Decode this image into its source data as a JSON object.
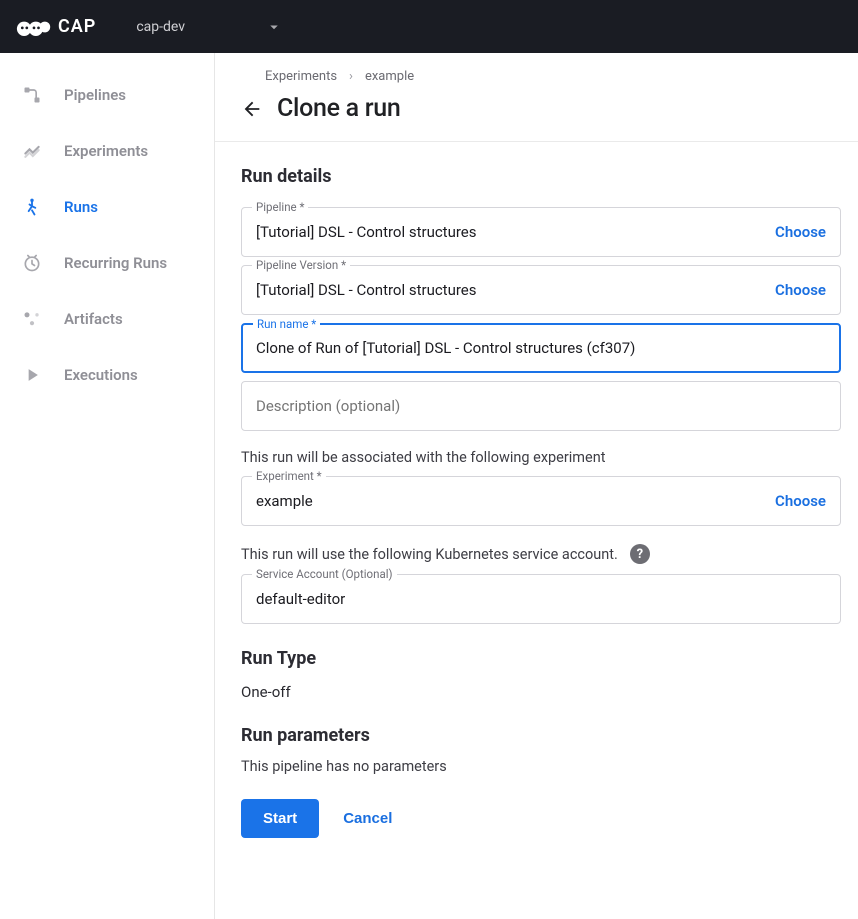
{
  "topbar": {
    "app_name": "CAP",
    "namespace": "cap-dev"
  },
  "sidebar": {
    "items": [
      {
        "label": "Pipelines",
        "icon": "pipelines"
      },
      {
        "label": "Experiments",
        "icon": "experiments"
      },
      {
        "label": "Runs",
        "icon": "runs",
        "active": true
      },
      {
        "label": "Recurring Runs",
        "icon": "clock"
      },
      {
        "label": "Artifacts",
        "icon": "artifacts"
      },
      {
        "label": "Executions",
        "icon": "play"
      }
    ]
  },
  "breadcrumb": {
    "root": "Experiments",
    "leaf": "example"
  },
  "page_title": "Clone a run",
  "sections": {
    "run_details": "Run details",
    "run_type": "Run Type",
    "run_parameters": "Run parameters"
  },
  "fields": {
    "pipeline": {
      "label": "Pipeline *",
      "value": "[Tutorial] DSL - Control structures",
      "action": "Choose"
    },
    "pipeline_version": {
      "label": "Pipeline Version *",
      "value": "[Tutorial] DSL - Control structures",
      "action": "Choose"
    },
    "run_name": {
      "label": "Run name *",
      "value": "Clone of Run of [Tutorial] DSL - Control structures (cf307)"
    },
    "description": {
      "placeholder": "Description (optional)"
    },
    "experiment_help": "This run will be associated with the following experiment",
    "experiment": {
      "label": "Experiment *",
      "value": "example",
      "action": "Choose"
    },
    "service_account_help": "This run will use the following Kubernetes service account.",
    "service_account": {
      "label": "Service Account (Optional)",
      "value": "default-editor"
    }
  },
  "run_type_value": "One-off",
  "run_parameters_empty": "This pipeline has no parameters",
  "buttons": {
    "start": "Start",
    "cancel": "Cancel"
  }
}
